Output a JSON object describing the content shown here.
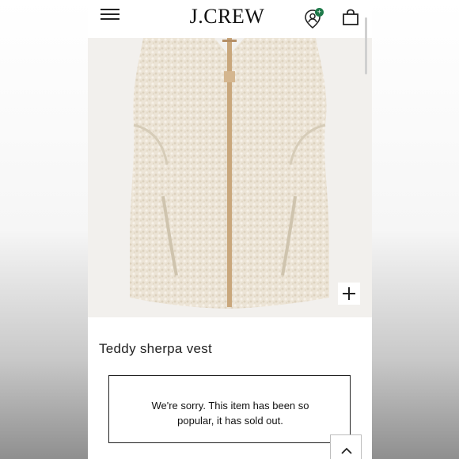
{
  "header": {
    "brand": "J.CREW",
    "account_badge": "+"
  },
  "product": {
    "title": "Teddy sherpa vest",
    "soldout_message": "We're sorry. This item has been so popular, it has sold out."
  },
  "icons": {
    "menu": "hamburger-menu-icon",
    "account": "account-icon",
    "bag": "shopping-bag-icon",
    "zoom": "plus-icon",
    "top": "chevron-up-icon"
  },
  "colors": {
    "vest": "#ece4d6",
    "zipper": "#c9a77c",
    "badge": "#1f7a4a"
  }
}
